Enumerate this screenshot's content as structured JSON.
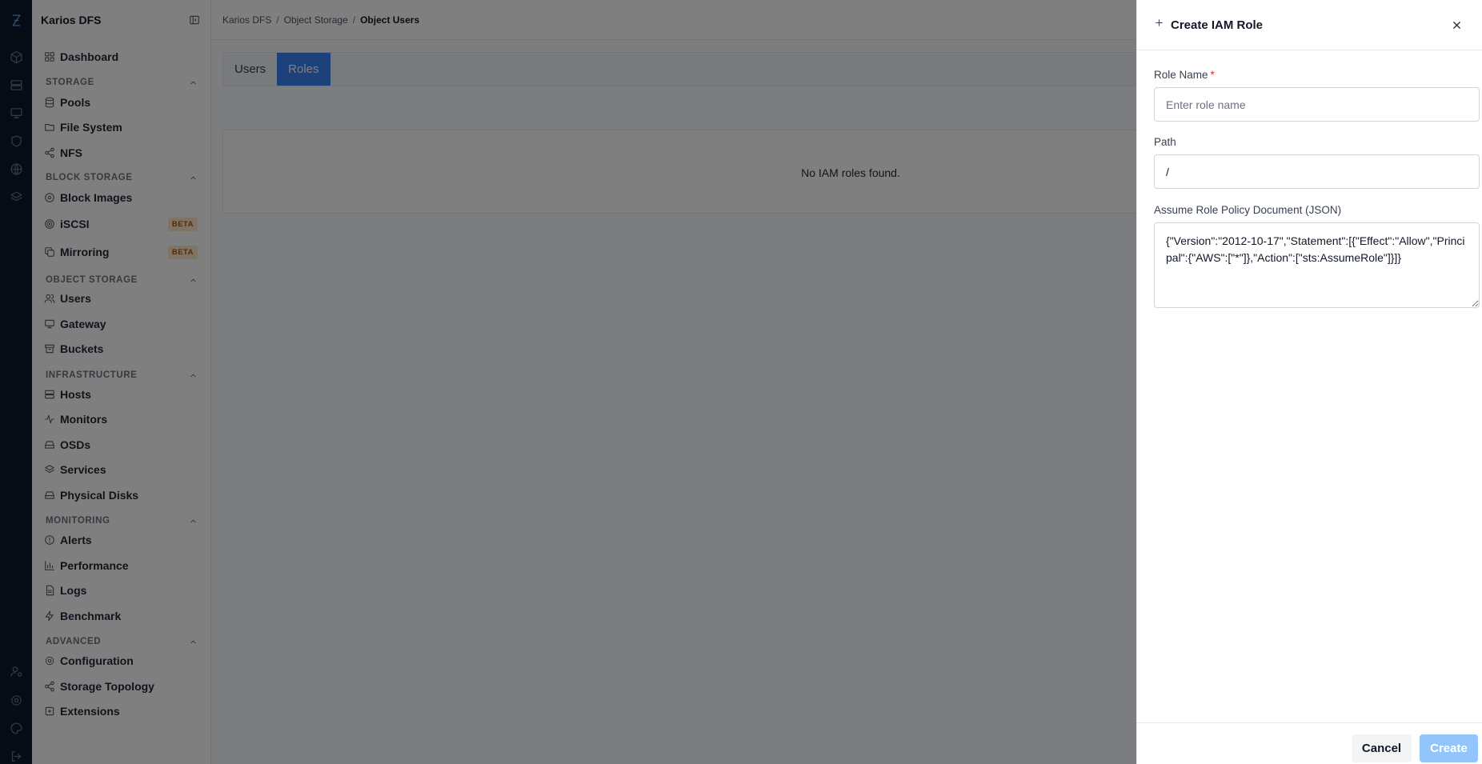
{
  "app": {
    "name": "Karios DFS"
  },
  "rail": {
    "icons": [
      "logo-icon",
      "cube-icon",
      "server-icon",
      "monitor-icon",
      "shield-icon",
      "globe-icon",
      "layers-icon",
      "user-settings-icon",
      "gear-icon",
      "palette-icon",
      "logout-icon"
    ]
  },
  "sidebar": {
    "dashboard": "Dashboard",
    "sections": {
      "storage": "STORAGE",
      "block_storage": "BLOCK STORAGE",
      "object_storage": "OBJECT STORAGE",
      "infrastructure": "INFRASTRUCTURE",
      "monitoring": "MONITORING",
      "advanced": "ADVANCED"
    },
    "items": {
      "pools": "Pools",
      "file_system": "File System",
      "nfs": "NFS",
      "block_images": "Block Images",
      "iscsi": "iSCSI",
      "mirroring": "Mirroring",
      "users": "Users",
      "gateway": "Gateway",
      "buckets": "Buckets",
      "hosts": "Hosts",
      "monitors": "Monitors",
      "osds": "OSDs",
      "services": "Services",
      "physical_disks": "Physical Disks",
      "alerts": "Alerts",
      "performance": "Performance",
      "logs": "Logs",
      "benchmark": "Benchmark",
      "configuration": "Configuration",
      "storage_topology": "Storage Topology",
      "extensions": "Extensions"
    },
    "beta_label": "BETA"
  },
  "breadcrumb": [
    "Karios DFS",
    "Object Storage",
    "Object Users"
  ],
  "tabs": {
    "users": "Users",
    "roles": "Roles",
    "active": "Roles"
  },
  "empty_message": "No IAM roles found.",
  "drawer": {
    "title": "Create IAM Role",
    "role_name": {
      "label": "Role Name",
      "required_mark": "*",
      "value": "",
      "placeholder": "Enter role name"
    },
    "path": {
      "label": "Path",
      "value": "/"
    },
    "policy": {
      "label": "Assume Role Policy Document (JSON)",
      "value": "{\"Version\":\"2012-10-17\",\"Statement\":[{\"Effect\":\"Allow\",\"Principal\":{\"AWS\":[\"*\"]},\"Action\":[\"sts:AssumeRole\"]}]}"
    },
    "cancel_label": "Cancel",
    "create_label": "Create"
  },
  "colors": {
    "accent": "#3b82f6",
    "rail_bg": "#0f172a",
    "create_disabled": "#93c5fd",
    "required": "#dc2626",
    "beta_bg": "#fde7c8",
    "beta_text": "#b45309"
  }
}
